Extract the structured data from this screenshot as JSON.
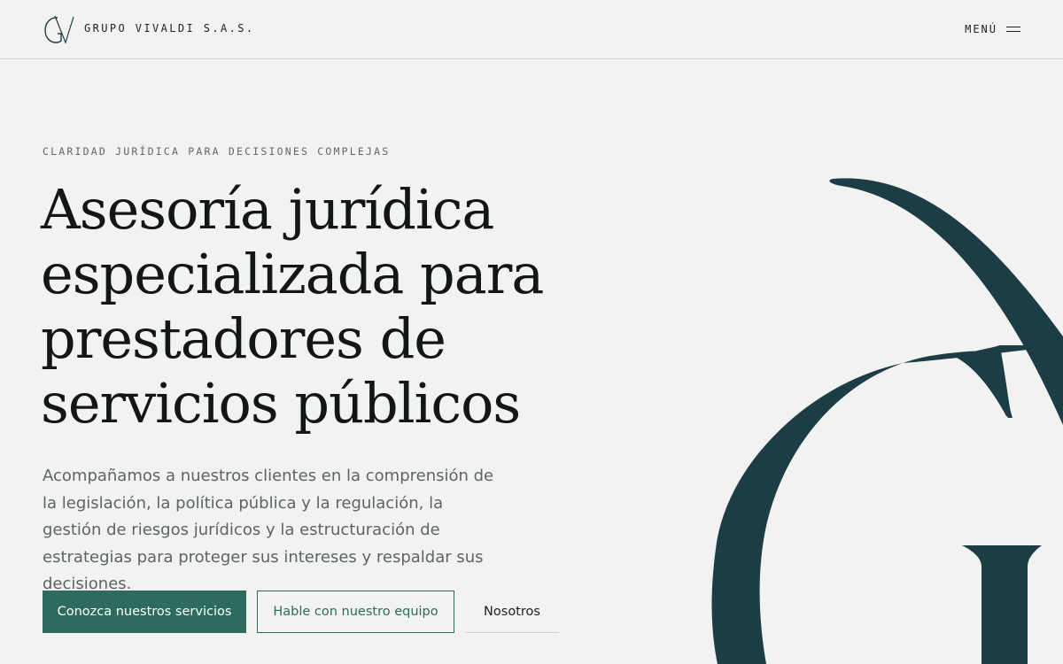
{
  "header": {
    "logo_icon": "gv-monogram-icon",
    "brand_name": "GRUPO VIVALDI S.A.S.",
    "menu_label": "MENÚ",
    "menu_icon": "hamburger-icon"
  },
  "hero": {
    "eyebrow": "CLARIDAD JURÍDICA PARA DECISIONES COMPLEJAS",
    "headline_lines": [
      "Asesoría jurídica",
      "especializada para",
      "prestadores de",
      "servicios públicos"
    ],
    "lead": "Acompañamos a nuestros clientes en la comprensión de la legislación, la política pública y la regulación, la gestión de riesgos jurídicos y la estructuración de estrategias para proteger sus intereses y respaldar sus decisiones.",
    "buttons": {
      "primary": "Conozca nuestros servicios",
      "secondary": "Hable con nuestro equipo",
      "tertiary": "Nosotros"
    },
    "decor_icon": "g-letter-decorative-icon"
  },
  "colors": {
    "background": "#f2f2f0",
    "accent_green": "#2c6b5d",
    "decor_teal": "#1c3d45",
    "text_dark": "#121617",
    "text_muted": "#5c6466"
  }
}
